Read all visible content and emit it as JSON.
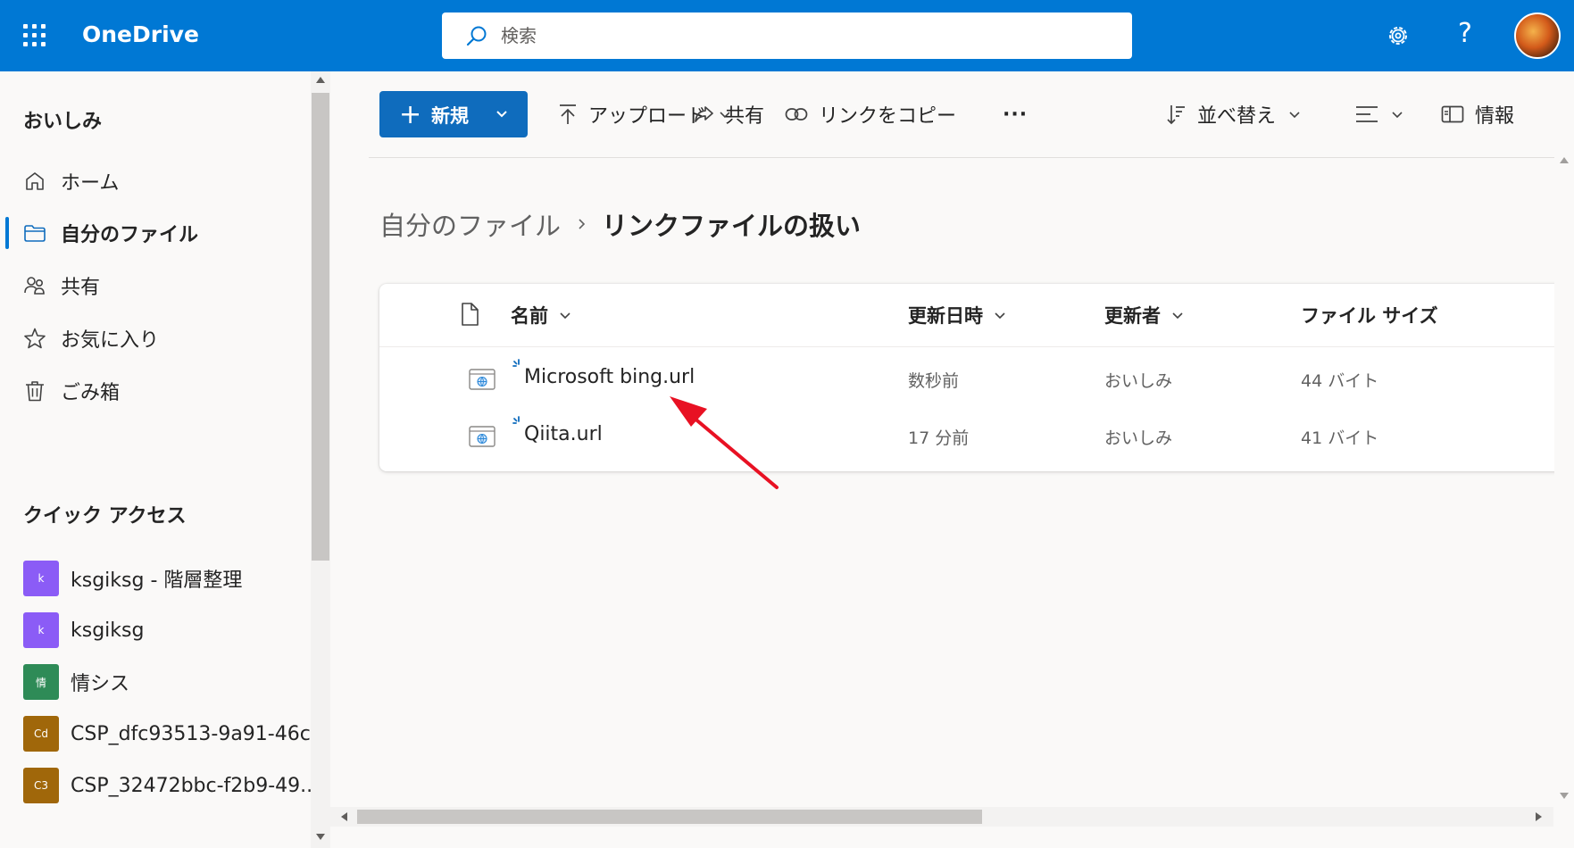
{
  "app": {
    "title": "OneDrive",
    "accent_color": "#0078d4",
    "waffle_icon": "app-launcher-icon"
  },
  "search": {
    "placeholder": "検索",
    "icon": "search-icon"
  },
  "header": {
    "settings_icon": "gear-icon",
    "help_label": "?",
    "avatar_icon": "avatar"
  },
  "sidebar": {
    "user_name": "おいしみ",
    "items": [
      {
        "label": "ホーム",
        "icon": "home-icon",
        "active": false
      },
      {
        "label": "自分のファイル",
        "icon": "folder-icon",
        "active": true
      },
      {
        "label": "共有",
        "icon": "people-icon",
        "active": false
      },
      {
        "label": "お気に入り",
        "icon": "star-icon",
        "active": false
      },
      {
        "label": "ごみ箱",
        "icon": "trash-icon",
        "active": false
      }
    ],
    "quick_access_title": "クイック アクセス",
    "quick_access": [
      {
        "badge": "k",
        "label": "ksgiksg - 階層整理",
        "color": "#8b5cf6"
      },
      {
        "badge": "k",
        "label": "ksgiksg",
        "color": "#8b5cf6"
      },
      {
        "badge": "情",
        "label": "情シス",
        "color": "#2e8b57"
      },
      {
        "badge": "Cd",
        "label": "CSP_dfc93513-9a91-46c...",
        "color": "#a0670a"
      },
      {
        "badge": "C3",
        "label": "CSP_32472bbc-f2b9-49...",
        "color": "#a0670a"
      }
    ]
  },
  "toolbar": {
    "new_label": "新規",
    "upload_label": "アップロード",
    "share_label": "共有",
    "copy_link_label": "リンクをコピー",
    "more_label": "···",
    "sort_label": "並べ替え",
    "info_label": "情報"
  },
  "breadcrumb": {
    "parent": "自分のファイル",
    "current": "リンクファイルの扱い"
  },
  "table": {
    "columns": [
      "名前",
      "更新日時",
      "更新者",
      "ファイル サイズ"
    ],
    "rows": [
      {
        "name": "Microsoft bing.url",
        "modified": "数秒前",
        "modified_by": "おいしみ",
        "size": "44 バイト"
      },
      {
        "name": "Qiita.url",
        "modified": "17 分前",
        "modified_by": "おいしみ",
        "size": "41 バイト"
      }
    ]
  },
  "annotation": {
    "arrow_color": "#e81123"
  }
}
